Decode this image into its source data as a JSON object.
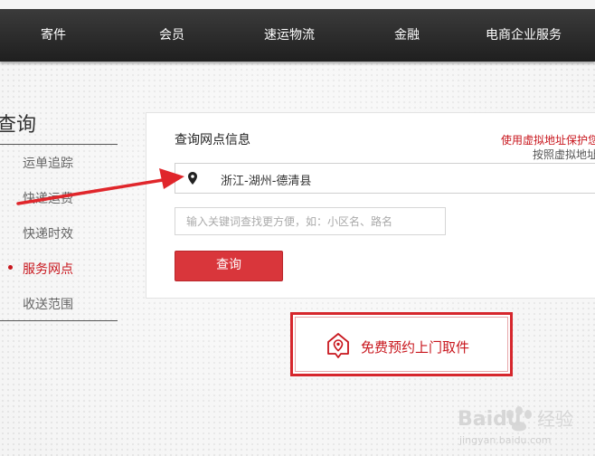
{
  "nav": {
    "items": [
      "寄件",
      "会员",
      "速运物流",
      "金融",
      "电商企业服务"
    ]
  },
  "sidebar": {
    "title": "查询",
    "items": [
      {
        "label": "运单追踪",
        "active": false
      },
      {
        "label": "快递运费",
        "active": false
      },
      {
        "label": "快递时效",
        "active": false
      },
      {
        "label": "服务网点",
        "active": true
      },
      {
        "label": "收送范围",
        "active": false
      }
    ]
  },
  "panel": {
    "title": "查询网点信息",
    "privacy_link": "使用虚拟地址保护您",
    "privacy_note": "按照虚拟地址",
    "location_value": "浙江-湖州-德清县",
    "location_icon": "map-pin-icon",
    "keyword_placeholder": "输入关键词查找更方便，如：小区名、路名",
    "search_label": "查询"
  },
  "pickup": {
    "label": "免费预约上门取件",
    "icon": "location-house-icon"
  },
  "watermark": {
    "brand": "Baidu",
    "suffix": "经验",
    "url": "jingyan.baidu.com"
  },
  "colors": {
    "accent_red": "#c8161d",
    "button_red": "#d9363b",
    "nav_bg": "#2b2b2b"
  }
}
